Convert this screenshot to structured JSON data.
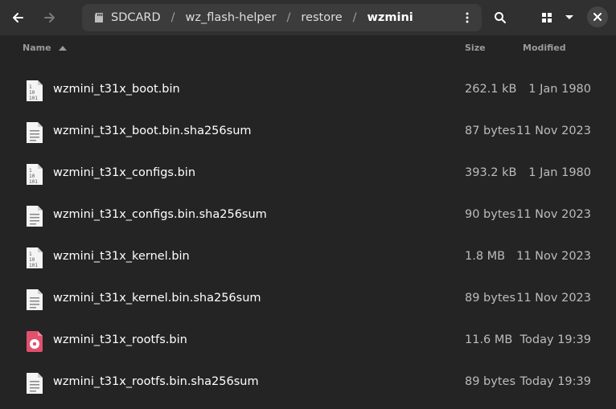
{
  "header": {
    "breadcrumb": [
      {
        "label": "SDCARD",
        "icon": "drive-icon"
      },
      {
        "label": "wz_flash-helper"
      },
      {
        "label": "restore"
      },
      {
        "label": "wzmini"
      }
    ],
    "separator": "/"
  },
  "columns": {
    "name": "Name",
    "size": "Size",
    "modified": "Modified"
  },
  "files": [
    {
      "name": "wzmini_t31x_boot.bin",
      "size": "262.1 kB",
      "modified": "1 Jan 1980",
      "icon": "binary-file-icon"
    },
    {
      "name": "wzmini_t31x_boot.bin.sha256sum",
      "size": "87 bytes",
      "modified": "11 Nov 2023",
      "icon": "text-file-icon"
    },
    {
      "name": "wzmini_t31x_configs.bin",
      "size": "393.2 kB",
      "modified": "1 Jan 1980",
      "icon": "binary-file-icon"
    },
    {
      "name": "wzmini_t31x_configs.bin.sha256sum",
      "size": "90 bytes",
      "modified": "11 Nov 2023",
      "icon": "text-file-icon"
    },
    {
      "name": "wzmini_t31x_kernel.bin",
      "size": "1.8 MB",
      "modified": "11 Nov 2023",
      "icon": "binary-file-icon"
    },
    {
      "name": "wzmini_t31x_kernel.bin.sha256sum",
      "size": "89 bytes",
      "modified": "11 Nov 2023",
      "icon": "text-file-icon"
    },
    {
      "name": "wzmini_t31x_rootfs.bin",
      "size": "11.6 MB",
      "modified": "Today 19:39",
      "icon": "disc-image-icon"
    },
    {
      "name": "wzmini_t31x_rootfs.bin.sha256sum",
      "size": "89 bytes",
      "modified": "Today 19:39",
      "icon": "text-file-icon"
    }
  ],
  "colors": {
    "background": "#242424",
    "headerbar": "#303030",
    "pathbar": "#3c3c3c",
    "disc_icon": "#e0516d"
  }
}
